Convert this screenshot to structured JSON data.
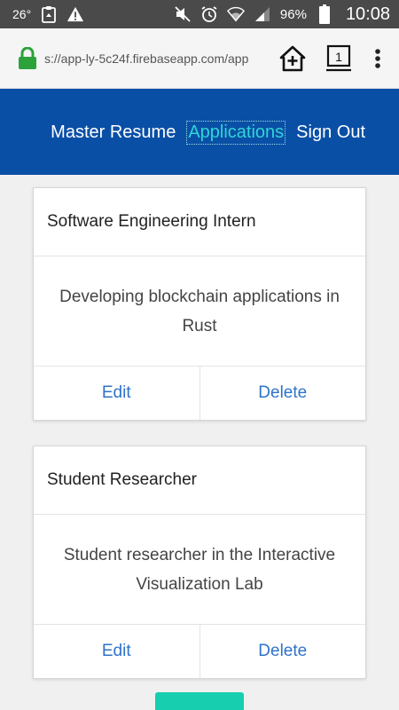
{
  "status_bar": {
    "temperature": "26°",
    "battery": "96%",
    "time": "10:08"
  },
  "browser": {
    "url": "s://app-ly-5c24f.firebaseapp.com/app",
    "tab_count": "1"
  },
  "nav": {
    "master_resume": "Master Resume",
    "applications": "Applications",
    "sign_out": "Sign Out"
  },
  "cards": [
    {
      "title": "Software Engineering Intern",
      "description": "Developing blockchain applications in Rust",
      "edit_label": "Edit",
      "delete_label": "Delete"
    },
    {
      "title": "Student Researcher",
      "description": "Student researcher in the Interactive Visualization Lab",
      "edit_label": "Edit",
      "delete_label": "Delete"
    }
  ],
  "colors": {
    "nav_background": "#0a4fa6",
    "nav_active": "#2fd5d5",
    "link_blue": "#2e73c9",
    "add_button": "#17cfae",
    "lock_green": "#2ba23a"
  }
}
